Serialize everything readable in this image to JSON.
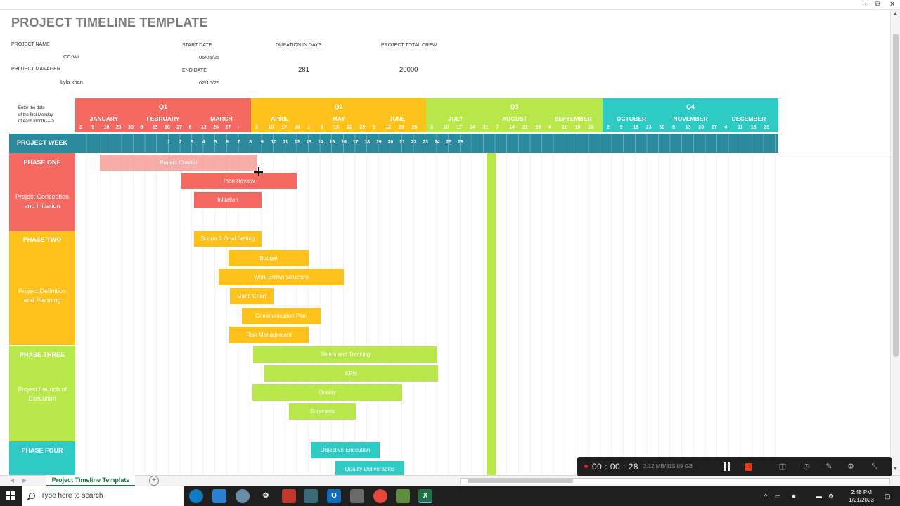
{
  "window": {
    "more": "···",
    "restore": "⧉",
    "close": "✕"
  },
  "sheet": {
    "title": "PROJECT TIMELINE TEMPLATE",
    "labels": {
      "project_name": "PROJECT NAME",
      "project_manager": "PROJECT MANAGER",
      "start_date": "START DATE",
      "end_date": "END DATE",
      "duration": "DURATION IN DAYS",
      "crew": "PROJECT TOTAL CREW"
    },
    "values": {
      "project_name": "CC-Wi",
      "project_manager": "Lyla khan",
      "start_date": "05/05/25",
      "end_date": "02/10/26",
      "duration": "281",
      "crew": "20000"
    },
    "note": [
      "Enter the date",
      "of the first Monday",
      "of each month ---->"
    ],
    "week_label": "PROJECT WEEK",
    "quarters": [
      {
        "name": "Q1",
        "color": "#f46a62",
        "months": [
          "JANUARY",
          "FEBRUARY",
          "MARCH"
        ],
        "days": [
          "2",
          "9",
          "16",
          "23",
          "30",
          "6",
          "13",
          "20",
          "27",
          "6",
          "13",
          "20",
          "27",
          "-"
        ]
      },
      {
        "name": "Q2",
        "color": "#ffc21c",
        "months": [
          "APRIL",
          "MAY",
          "JUNE"
        ],
        "days": [
          "3",
          "10",
          "17",
          "24",
          "1",
          "8",
          "15",
          "22",
          "29",
          "5",
          "12",
          "19",
          "26"
        ]
      },
      {
        "name": "Q3",
        "color": "#b9e84a",
        "months": [
          "JULY",
          "AUGUST",
          "SEPTEMBER"
        ],
        "days": [
          "3",
          "10",
          "17",
          "24",
          "31",
          "7",
          "14",
          "21",
          "28",
          "4",
          "11",
          "18",
          "25"
        ]
      },
      {
        "name": "Q4",
        "color": "#2ecbc4",
        "months": [
          "OCTOBER",
          "NOVEMBER",
          "DECEMBER"
        ],
        "days": [
          "2",
          "9",
          "16",
          "23",
          "30",
          "6",
          "13",
          "20",
          "27",
          "4",
          "11",
          "18",
          "25"
        ]
      }
    ],
    "weeks": [
      "1",
      "2",
      "3",
      "4",
      "5",
      "6",
      "7",
      "8",
      "9",
      "10",
      "11",
      "12",
      "13",
      "14",
      "15",
      "16",
      "17",
      "18",
      "19",
      "20",
      "21",
      "22",
      "23",
      "24",
      "25",
      "26"
    ],
    "phases": [
      {
        "title": "PHASE ONE",
        "desc1": "Project Conception",
        "desc2": "and Initiation",
        "color": "#f46a62",
        "tasks": [
          "Project Charter",
          "Plan Review",
          "Initiation"
        ]
      },
      {
        "title": "PHASE TWO",
        "desc1": "Project Definition",
        "desc2": "and Planning",
        "color": "#ffc21c",
        "tasks": [
          "Scope & Goal Setting",
          "Budget",
          "Work Brdwn Structure",
          "Gantt Chart",
          "Communication Plan",
          "Risk Management"
        ]
      },
      {
        "title": "PHASE THREE",
        "desc1": "Project Launch of",
        "desc2": "Execution",
        "color": "#b9e84a",
        "tasks": [
          "Status and Tracking",
          "KPIs",
          "Quality",
          "Forecasts"
        ]
      },
      {
        "title": "PHASE FOUR",
        "desc1": "",
        "desc2": "",
        "color": "#2ecbc4",
        "tasks": [
          "Objective Execution",
          "Quality Deliverables"
        ]
      }
    ]
  },
  "tabs": {
    "active": "Project Timeline Template",
    "add": "+"
  },
  "recorder": {
    "time": "00 : 00 : 28",
    "size": "2.12 MB/315.89 GB"
  },
  "taskbar": {
    "search_placeholder": "Type here to search",
    "time": "2:48 PM",
    "date": "1/21/2023",
    "excel": "X",
    "outlook": "O"
  }
}
